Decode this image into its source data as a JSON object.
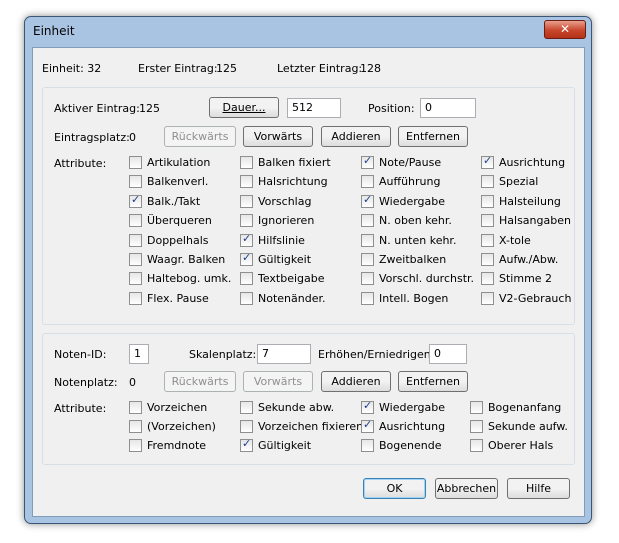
{
  "window": {
    "title": "Einheit",
    "close_symbol": "✕"
  },
  "info": {
    "einheit": "Einheit: 32",
    "erster": "Erster Eintrag:",
    "erster_value": "125",
    "letzter": "Letzter Eintrag:",
    "letzter_value": "128"
  },
  "entry": {
    "aktiver_label": "Aktiver Eintrag:",
    "aktiver_value": "125",
    "dauer_button": "Dauer...",
    "dauer_value": "512",
    "position_label": "Position:",
    "position_value": "0",
    "eintragsplatz_label": "Eintragsplatz:",
    "eintragsplatz_value": "0",
    "rueckwaerts": "Rückwärts",
    "vorwaerts": "Vorwärts",
    "addieren": "Addieren",
    "entfernen": "Entfernen",
    "attribute_label": "Attribute:",
    "attributes": [
      {
        "label": "Artikulation",
        "checked": false
      },
      {
        "label": "Balken fixiert",
        "checked": false
      },
      {
        "label": "Note/Pause",
        "checked": true
      },
      {
        "label": "Ausrichtung",
        "checked": true
      },
      {
        "label": "Balkenverl.",
        "checked": false
      },
      {
        "label": "Halsrichtung",
        "checked": false
      },
      {
        "label": "Aufführung",
        "checked": false
      },
      {
        "label": "Spezial",
        "checked": false
      },
      {
        "label": "Balk./Takt",
        "checked": true
      },
      {
        "label": "Vorschlag",
        "checked": false
      },
      {
        "label": "Wiedergabe",
        "checked": true
      },
      {
        "label": "Halsteilung",
        "checked": false
      },
      {
        "label": "Überqueren",
        "checked": false
      },
      {
        "label": "Ignorieren",
        "checked": false
      },
      {
        "label": "N. oben kehr.",
        "checked": false
      },
      {
        "label": "Halsangaben",
        "checked": false
      },
      {
        "label": "Doppelhals",
        "checked": false
      },
      {
        "label": "Hilfslinie",
        "checked": true
      },
      {
        "label": "N. unten kehr.",
        "checked": false
      },
      {
        "label": "X-tole",
        "checked": false
      },
      {
        "label": "Waagr. Balken",
        "checked": false
      },
      {
        "label": "Gültigkeit",
        "checked": true
      },
      {
        "label": "Zweitbalken",
        "checked": false
      },
      {
        "label": "Aufw./Abw.",
        "checked": false
      },
      {
        "label": "Haltebog. umk.",
        "checked": false
      },
      {
        "label": "Textbeigabe",
        "checked": false
      },
      {
        "label": "Vorschl. durchstr.",
        "checked": false
      },
      {
        "label": "Stimme 2",
        "checked": false
      },
      {
        "label": "Flex. Pause",
        "checked": false
      },
      {
        "label": "Notenänder.",
        "checked": false
      },
      {
        "label": "Intell. Bogen",
        "checked": false
      },
      {
        "label": "V2-Gebrauch",
        "checked": false
      }
    ]
  },
  "note": {
    "noten_id_label": "Noten-ID:",
    "noten_id_value": "1",
    "skalenplatz_label": "Skalenplatz:",
    "skalenplatz_value": "7",
    "erhoehen_label": "Erhöhen/Erniedrigen:",
    "erhoehen_value": "0",
    "notenplatz_label": "Notenplatz:",
    "notenplatz_value": "0",
    "rueckwaerts": "Rückwärts",
    "vorwaerts": "Vorwärts",
    "addieren": "Addieren",
    "entfernen": "Entfernen",
    "attribute_label": "Attribute:",
    "attributes": [
      {
        "label": "Vorzeichen",
        "checked": false
      },
      {
        "label": "Sekunde abw.",
        "checked": false
      },
      {
        "label": "Wiedergabe",
        "checked": true
      },
      {
        "label": "Bogenanfang",
        "checked": false
      },
      {
        "label": "(Vorzeichen)",
        "checked": false
      },
      {
        "label": "Vorzeichen fixieren",
        "checked": false
      },
      {
        "label": "Ausrichtung",
        "checked": true
      },
      {
        "label": "Sekunde aufw.",
        "checked": false
      },
      {
        "label": "Fremdnote",
        "checked": false
      },
      {
        "label": "Gültigkeit",
        "checked": true
      },
      {
        "label": "Bogenende",
        "checked": false
      },
      {
        "label": "Oberer Hals",
        "checked": false
      }
    ]
  },
  "footer": {
    "ok": "OK",
    "abbrechen": "Abbrechen",
    "hilfe": "Hilfe"
  }
}
